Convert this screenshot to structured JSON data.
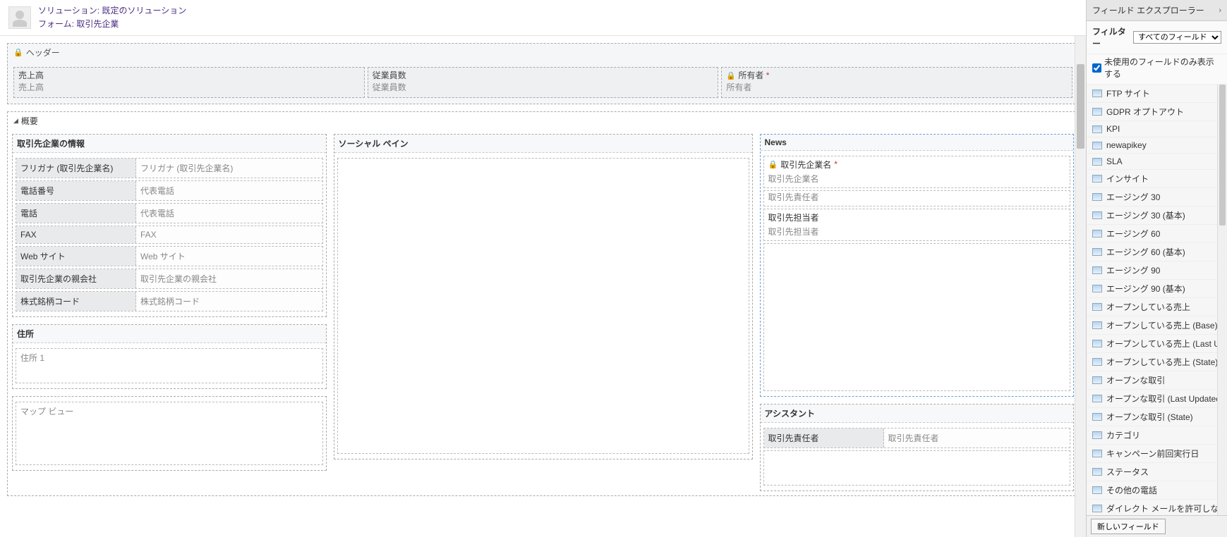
{
  "topbar": {
    "solution_prefix": "ソリューション: ",
    "solution_name": "既定のソリューション",
    "form_prefix": "フォーム: ",
    "form_name": "取引先企業"
  },
  "header_section": {
    "title": "ヘッダー",
    "fields": [
      {
        "label": "売上高",
        "placeholder": "売上高",
        "locked": false,
        "required": false
      },
      {
        "label": "従業員数",
        "placeholder": "従業員数",
        "locked": false,
        "required": false
      },
      {
        "label": "所有者",
        "placeholder": "所有者",
        "locked": true,
        "required": true
      }
    ]
  },
  "tab": {
    "title": "概要"
  },
  "col1": {
    "section1_title": "取引先企業の情報",
    "fields": [
      {
        "label": "フリガナ (取引先企業名)",
        "placeholder": "フリガナ (取引先企業名)"
      },
      {
        "label": "電話番号",
        "placeholder": "代表電話"
      },
      {
        "label": "電話",
        "placeholder": "代表電話"
      },
      {
        "label": "FAX",
        "placeholder": "FAX"
      },
      {
        "label": "Web サイト",
        "placeholder": "Web サイト"
      },
      {
        "label": "取引先企業の親会社",
        "placeholder": "取引先企業の親会社"
      },
      {
        "label": "株式銘柄コード",
        "placeholder": "株式銘柄コード"
      }
    ],
    "section2_title": "住所",
    "address_placeholder": "住所 1",
    "map_placeholder": "マップ ビュー"
  },
  "col2": {
    "title": "ソーシャル ペイン"
  },
  "col3": {
    "news_title": "News",
    "news_fields": [
      {
        "label": "取引先企業名",
        "placeholder": "取引先企業名",
        "locked": true,
        "required": true
      },
      {
        "label": "",
        "placeholder": "取引先責任者",
        "locked": false,
        "required": false
      },
      {
        "label": "取引先担当者",
        "placeholder": "取引先担当者",
        "locked": false,
        "required": false
      }
    ],
    "assistant_title": "アシスタント",
    "assistant_field": {
      "label": "取引先責任者",
      "placeholder": "取引先責任者"
    }
  },
  "explorer": {
    "title": "フィールド エクスプローラー",
    "filter_label": "フィルター",
    "filter_value": "すべてのフィールド",
    "checkbox_label": "未使用のフィールドのみ表示する",
    "items": [
      "FTP サイト",
      "GDPR オプトアウト",
      "KPI",
      "newapikey",
      "SLA",
      "インサイト",
      "エージング 30",
      "エージング 30 (基本)",
      "エージング 60",
      "エージング 60 (基本)",
      "エージング 90",
      "エージング 90 (基本)",
      "オープンしている売上",
      "オープンしている売上 (Base)",
      "オープンしている売上 (Last Update…",
      "オープンしている売上 (State)",
      "オープンな取引",
      "オープンな取引 (Last Updated On)",
      "オープンな取引 (State)",
      "カテゴリ",
      "キャンペーン前回実行日",
      "ステータス",
      "その他の電話",
      "ダイレクト メールを許可しない"
    ],
    "new_button": "新しいフィールド"
  }
}
